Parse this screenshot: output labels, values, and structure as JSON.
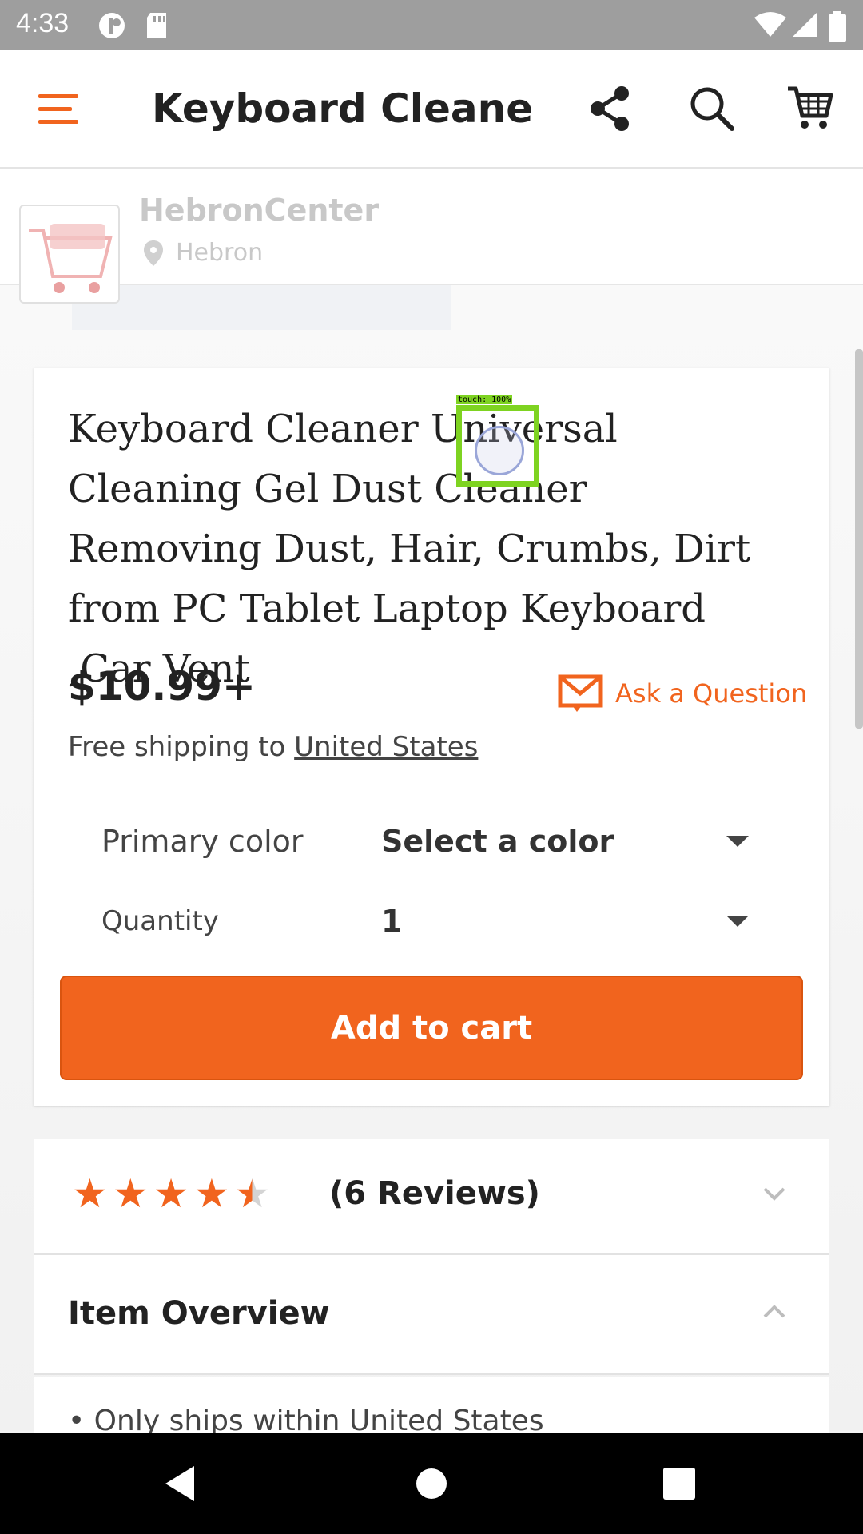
{
  "status_bar": {
    "time": "4:33"
  },
  "app_bar": {
    "title": "Keyboard Cleane…"
  },
  "shop": {
    "name": "HebronCenter",
    "location": "Hebron"
  },
  "product": {
    "title": "Keyboard Cleaner Universal Cleaning Gel Dust Cleaner Removing Dust, Hair, Crumbs, Dirt from PC Tablet Laptop Keyboard ,Car Vent",
    "price": "$10.99+",
    "ask_question": "Ask a Question",
    "shipping_prefix": "Free shipping to ",
    "shipping_country": "United States",
    "options": {
      "color_label": "Primary color",
      "color_value": "Select a color",
      "quantity_label": "Quantity",
      "quantity_value": "1"
    },
    "add_to_cart": "Add to cart"
  },
  "touch_overlay": {
    "label": "touch: 100%"
  },
  "reviews": {
    "rating": 4.5,
    "stars_max": 5,
    "count_label": "(6 Reviews)"
  },
  "overview": {
    "title": "Item Overview",
    "first_item": "• Only ships within United States"
  },
  "colors": {
    "accent": "#f1641e",
    "status_bar": "#9e9e9e",
    "touch_box": "#7ed321"
  },
  "icons": [
    "menu-icon",
    "share-icon",
    "search-icon",
    "cart-icon",
    "location-pin-icon",
    "mail-icon",
    "back-icon",
    "home-icon",
    "recents-icon"
  ]
}
